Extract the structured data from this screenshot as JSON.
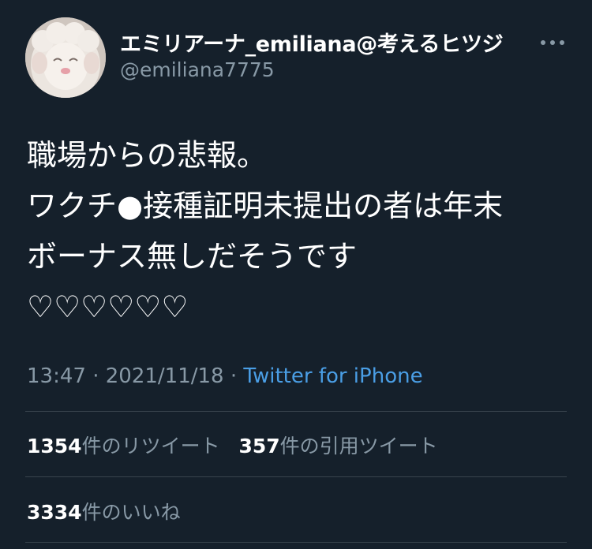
{
  "user": {
    "display_name": "エミリアーナ_emiliana@考えるヒツジ",
    "handle": "@emiliana7775",
    "avatar_icon": "sheep-plush-avatar"
  },
  "more_icon": "more-horizontal-icon",
  "tweet": {
    "lines": [
      "職場からの悲報。",
      "ワクチ●接種証明未提出の者は年末",
      "ボーナス無しだそうです",
      "♡♡♡♡♡♡"
    ]
  },
  "meta": {
    "time": "13:47",
    "separator": " · ",
    "date": "2021/11/18",
    "source": "Twitter for iPhone"
  },
  "stats": {
    "retweets_count": "1354",
    "retweets_label": "件のリツイート",
    "quotes_count": "357",
    "quotes_label": "件の引用ツイート",
    "likes_count": "3334",
    "likes_label": "件のいいね"
  },
  "colors": {
    "background": "#15202b",
    "text": "#ffffff",
    "secondary": "#8899a6",
    "link": "#4a9ee5",
    "divider": "#38444d"
  }
}
